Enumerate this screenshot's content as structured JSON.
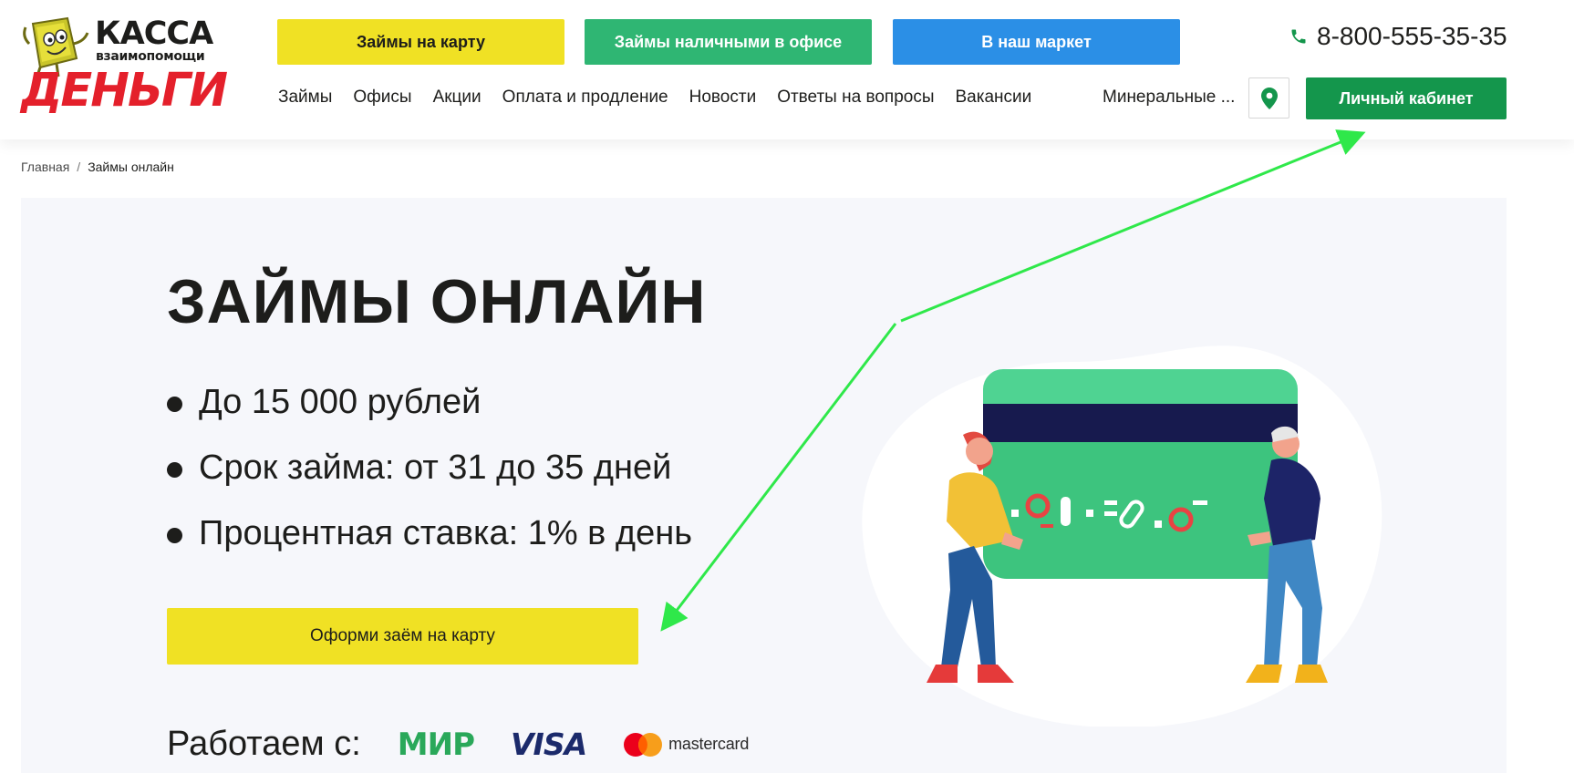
{
  "logo": {
    "line1": "КАССА",
    "line2": "взаимопомощи",
    "line3": "ДЕНЬГИ"
  },
  "header": {
    "buttons": [
      {
        "label": "Займы на карту"
      },
      {
        "label": "Займы наличными в офисе"
      },
      {
        "label": "В наш маркет"
      }
    ],
    "phone": "8-800-555-35-35",
    "nav": [
      {
        "label": "Займы"
      },
      {
        "label": "Офисы"
      },
      {
        "label": "Акции"
      },
      {
        "label": "Оплата и продление"
      },
      {
        "label": "Новости"
      },
      {
        "label": "Ответы на вопросы"
      },
      {
        "label": "Вакансии"
      }
    ],
    "city": "Минеральные ...",
    "cabinet_label": "Личный кабинет"
  },
  "breadcrumb": {
    "items": [
      "Главная",
      "Займы онлайн"
    ],
    "separator": "/"
  },
  "hero": {
    "title": "ЗАЙМЫ ОНЛАЙН",
    "bullets": [
      "До 15 000 рублей",
      "Срок займа: от 31 до 35 дней",
      "Процентная ставка: 1% в день"
    ],
    "cta_label": "Оформи заём на карту",
    "works_label": "Работаем с:",
    "payment_logos": {
      "mir": "МИР",
      "visa": "VISA",
      "mastercard": "mastercard"
    }
  },
  "colors": {
    "yellow": "#f0e124",
    "green": "#2fb673",
    "blue": "#2b8fe6",
    "dark_green": "#14964c",
    "brand_red": "#e4202b",
    "annotation_arrow": "#2fe84a"
  },
  "icons": {
    "phone": "phone-icon",
    "location": "map-pin-icon"
  }
}
